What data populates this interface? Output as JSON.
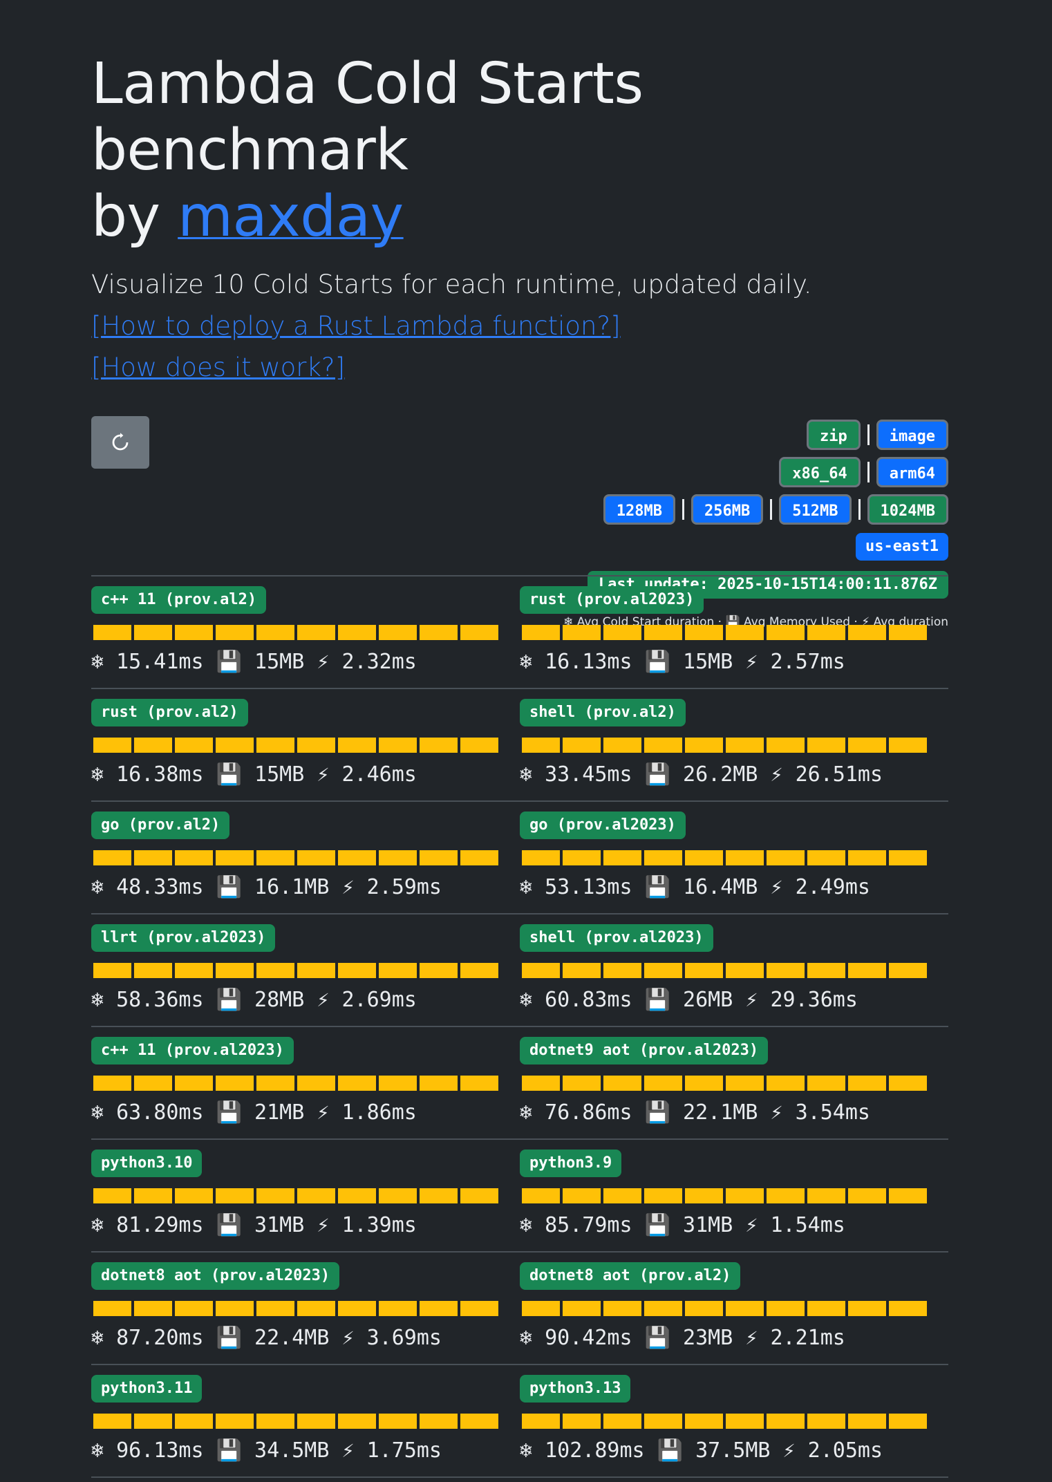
{
  "header": {
    "title_prefix": "Lambda Cold Starts benchmark",
    "by": "by",
    "author": "maxday",
    "subtitle": "Visualize 10 Cold Starts for each runtime, updated daily.",
    "link_rust": "[How to deploy a Rust Lambda function?]",
    "link_how": "[How does it work?]"
  },
  "filters": {
    "package": [
      "zip",
      "image"
    ],
    "arch": [
      "x86_64",
      "arm64"
    ],
    "memory": [
      "128MB",
      "256MB",
      "512MB",
      "1024MB"
    ],
    "region": "us-east1",
    "last_update": "Last update: 2025-10-15T14:00:11.876Z",
    "legend": "❄ Avg Cold Start duration · 💾 Avg Memory Used · ⚡ Avg duration"
  },
  "icons": {
    "cold": "❄",
    "memory": "💾",
    "duration": "⚡"
  },
  "runtimes": [
    {
      "name": "c++ 11 (prov.al2)",
      "cold": "15.41ms",
      "mem": "15MB",
      "dur": "2.32ms"
    },
    {
      "name": "rust (prov.al2023)",
      "cold": "16.13ms",
      "mem": "15MB",
      "dur": "2.57ms"
    },
    {
      "name": "rust (prov.al2)",
      "cold": "16.38ms",
      "mem": "15MB",
      "dur": "2.46ms"
    },
    {
      "name": "shell (prov.al2)",
      "cold": "33.45ms",
      "mem": "26.2MB",
      "dur": "26.51ms"
    },
    {
      "name": "go (prov.al2)",
      "cold": "48.33ms",
      "mem": "16.1MB",
      "dur": "2.59ms"
    },
    {
      "name": "go (prov.al2023)",
      "cold": "53.13ms",
      "mem": "16.4MB",
      "dur": "2.49ms"
    },
    {
      "name": "llrt (prov.al2023)",
      "cold": "58.36ms",
      "mem": "28MB",
      "dur": "2.69ms"
    },
    {
      "name": "shell (prov.al2023)",
      "cold": "60.83ms",
      "mem": "26MB",
      "dur": "29.36ms"
    },
    {
      "name": "c++ 11 (prov.al2023)",
      "cold": "63.80ms",
      "mem": "21MB",
      "dur": "1.86ms"
    },
    {
      "name": "dotnet9 aot (prov.al2023)",
      "cold": "76.86ms",
      "mem": "22.1MB",
      "dur": "3.54ms"
    },
    {
      "name": "python3.10",
      "cold": "81.29ms",
      "mem": "31MB",
      "dur": "1.39ms"
    },
    {
      "name": "python3.9",
      "cold": "85.79ms",
      "mem": "31MB",
      "dur": "1.54ms"
    },
    {
      "name": "dotnet8 aot (prov.al2023)",
      "cold": "87.20ms",
      "mem": "22.4MB",
      "dur": "3.69ms"
    },
    {
      "name": "dotnet8 aot (prov.al2)",
      "cold": "90.42ms",
      "mem": "23MB",
      "dur": "2.21ms"
    },
    {
      "name": "python3.11",
      "cold": "96.13ms",
      "mem": "34.5MB",
      "dur": "1.75ms"
    },
    {
      "name": "python3.13",
      "cold": "102.89ms",
      "mem": "37.5MB",
      "dur": "2.05ms"
    }
  ]
}
